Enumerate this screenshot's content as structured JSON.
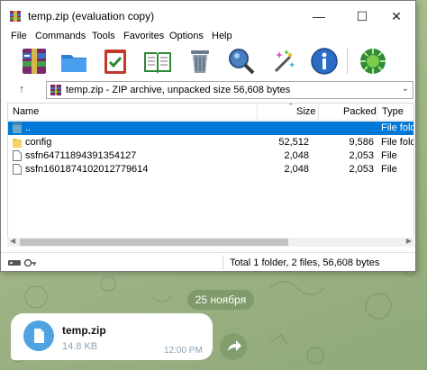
{
  "window": {
    "title": "temp.zip (evaluation copy)",
    "controls": [
      "—",
      "☐",
      "✕"
    ]
  },
  "menu": [
    "File",
    "Commands",
    "Tools",
    "Favorites",
    "Options",
    "Help"
  ],
  "toolbar": {
    "buttons": [
      "add-icon",
      "extract-to-icon",
      "test-icon",
      "view-icon",
      "delete-icon",
      "find-icon",
      "wizard-icon",
      "info-icon",
      "virus-scan-icon"
    ]
  },
  "address": {
    "up": "↑",
    "path": "temp.zip - ZIP archive, unpacked size 56,608 bytes",
    "chevron": "⌄"
  },
  "columns": {
    "name": "Name",
    "size": "Size",
    "packed": "Packed",
    "type": "Type"
  },
  "rows": [
    {
      "name": "..",
      "size": "",
      "packed": "",
      "type": "File fold"
    },
    {
      "name": "config",
      "size": "52,512",
      "packed": "9,586",
      "type": "File fold"
    },
    {
      "name": "ssfn64711894391354127",
      "size": "2,048",
      "packed": "2,053",
      "type": "File"
    },
    {
      "name": "ssfn1601874102012779614",
      "size": "2,048",
      "packed": "2,053",
      "type": "File"
    }
  ],
  "scroll": {
    "left": "◀",
    "right": "▶"
  },
  "status": {
    "summary": "Total 1 folder, 2 files, 56,608 bytes"
  },
  "chat": {
    "date": "25 ноября",
    "file_name": "temp.zip",
    "file_size": "14.8 KB",
    "time": "12:00 PM"
  },
  "colors": {
    "selection": "#0078d7",
    "chat_accent": "#4fa3e0",
    "chat_bg": "#a2b589"
  }
}
